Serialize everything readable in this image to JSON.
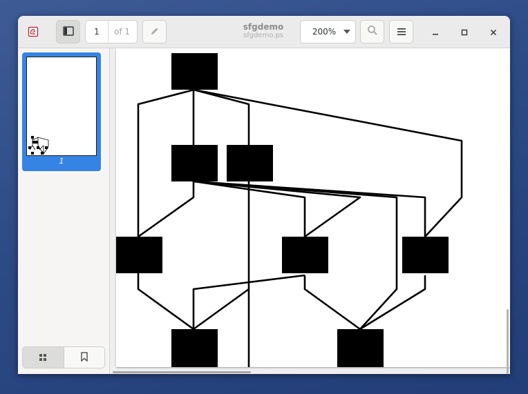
{
  "window": {
    "title": "sfgdemo",
    "subtitle": "sfgdemo.ps"
  },
  "toolbar": {
    "app_icon": "evince-document-icon",
    "sidebar_toggle_icon": "sidebar-show-icon",
    "page_number": "1",
    "page_of": "of 1",
    "annotate_icon": "pencil-icon",
    "zoom_value": "200%",
    "zoom_arrow_icon": "pan-down-icon",
    "search_icon": "search-icon",
    "menu_icon": "hamburger-menu-icon",
    "minimize_icon": "minimize-icon",
    "maximize_icon": "maximize-icon",
    "close_icon": "close-icon"
  },
  "sidebar": {
    "thumbnails": [
      {
        "label": "1",
        "selected": true
      }
    ],
    "mode_buttons": [
      {
        "icon": "thumbnails-grid-icon",
        "active": true
      },
      {
        "icon": "bookmark-icon",
        "active": false
      }
    ]
  },
  "document": {
    "accent_color": "#3584e4",
    "content": "signal flow graph diagram (black boxes connected by lines)"
  }
}
